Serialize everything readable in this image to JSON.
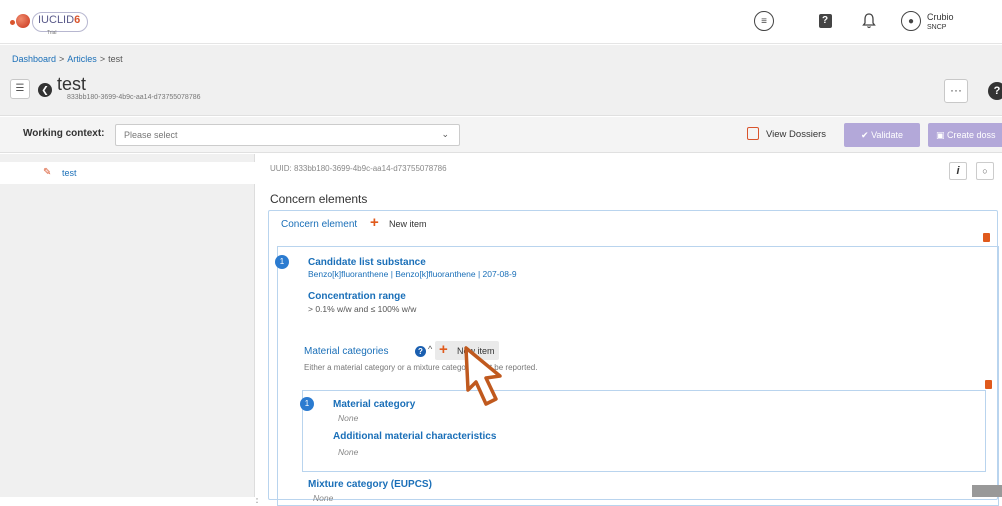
{
  "app": {
    "logo_text": "IUCLID",
    "logo_version": "6",
    "logo_edition": "Trial"
  },
  "topbar": {
    "user_name": "Crubio",
    "user_org": "SNCP",
    "icons": [
      "menu-icon",
      "help-icon",
      "bell-icon",
      "user-icon"
    ]
  },
  "breadcrumb": {
    "items": [
      "Dashboard",
      "Articles"
    ],
    "current": "test",
    "separator": ">"
  },
  "document": {
    "title": "test",
    "uuid": "833bb180-3699-4b9c-aa14-d73755078786"
  },
  "context": {
    "label": "Working context:",
    "placeholder": "Please select",
    "view_dossiers": "View Dossiers",
    "validate": "Validate",
    "create_dossier": "Create doss"
  },
  "tree": {
    "items": [
      {
        "label": "test"
      }
    ]
  },
  "main": {
    "uuid_line": "UUID: 833bb180-3699-4b9c-aa14-d73755078786",
    "info_label": "i",
    "section_title": "Concern elements",
    "concern_element_label": "Concern element",
    "new_item": "New item",
    "item_number": "1",
    "candidate_label": "Candidate list substance",
    "candidate_value": "Benzo[k]fluoranthene | Benzo[k]fluoranthene | 207-08-9",
    "concentration_label": "Concentration range",
    "concentration_value": "> 0.1% w/w and ≤ 100% w/w",
    "material_categories_label": "Material categories",
    "material_new_item": "New item",
    "material_hint": "Either a material category or a mixture category must be reported.",
    "sub_item_number": "1",
    "material_category_label": "Material category",
    "material_category_value": "None",
    "additional_label": "Additional material characteristics",
    "additional_value": "None",
    "mixture_label": "Mixture category (EUPCS)",
    "mixture_value": "None"
  }
}
